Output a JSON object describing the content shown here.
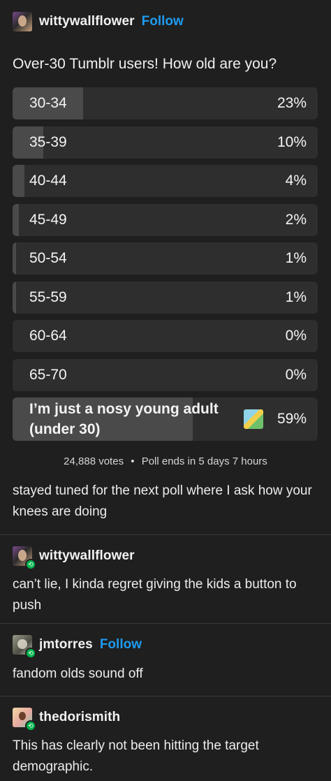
{
  "post": {
    "author": "wittywallflower",
    "follow_label": "Follow",
    "question": "Over-30 Tumblr users! How old are you?",
    "options": [
      {
        "label": "30-34",
        "percent": "23%",
        "value": 23
      },
      {
        "label": "35-39",
        "percent": "10%",
        "value": 10
      },
      {
        "label": "40-44",
        "percent": "4%",
        "value": 4
      },
      {
        "label": "45-49",
        "percent": "2%",
        "value": 2
      },
      {
        "label": "50-54",
        "percent": "1%",
        "value": 1
      },
      {
        "label": "55-59",
        "percent": "1%",
        "value": 1
      },
      {
        "label": "60-64",
        "percent": "0%",
        "value": 0
      },
      {
        "label": "65-70",
        "percent": "0%",
        "value": 0
      },
      {
        "label": "I’m just a nosy young adult (under 30)",
        "percent": "59%",
        "value": 59
      }
    ],
    "votes": "24,888 votes",
    "bullet": "•",
    "ends": "Poll ends in 5 days 7 hours",
    "caption": "stayed tuned for the next poll where I ask how your knees are doing"
  },
  "reblogs": [
    {
      "author": "wittywallflower",
      "text": "can’t lie, I kinda regret giving the kids a button to push"
    },
    {
      "author": "jmtorres",
      "follow_label": "Follow",
      "text": "fandom olds sound off"
    },
    {
      "author": "thedorismith",
      "text": "This has clearly not been hitting the target demographic."
    }
  ],
  "colors": {
    "background": "#1f1f1f",
    "bar_track": "#2e2e2e",
    "bar_fill": "#4a4a4a",
    "follow_link": "#1e9bf0",
    "reblog_badge": "#00b34c"
  },
  "icons": {
    "reblog_badge": "reblog-icon",
    "emoji": "poll-option-image"
  }
}
